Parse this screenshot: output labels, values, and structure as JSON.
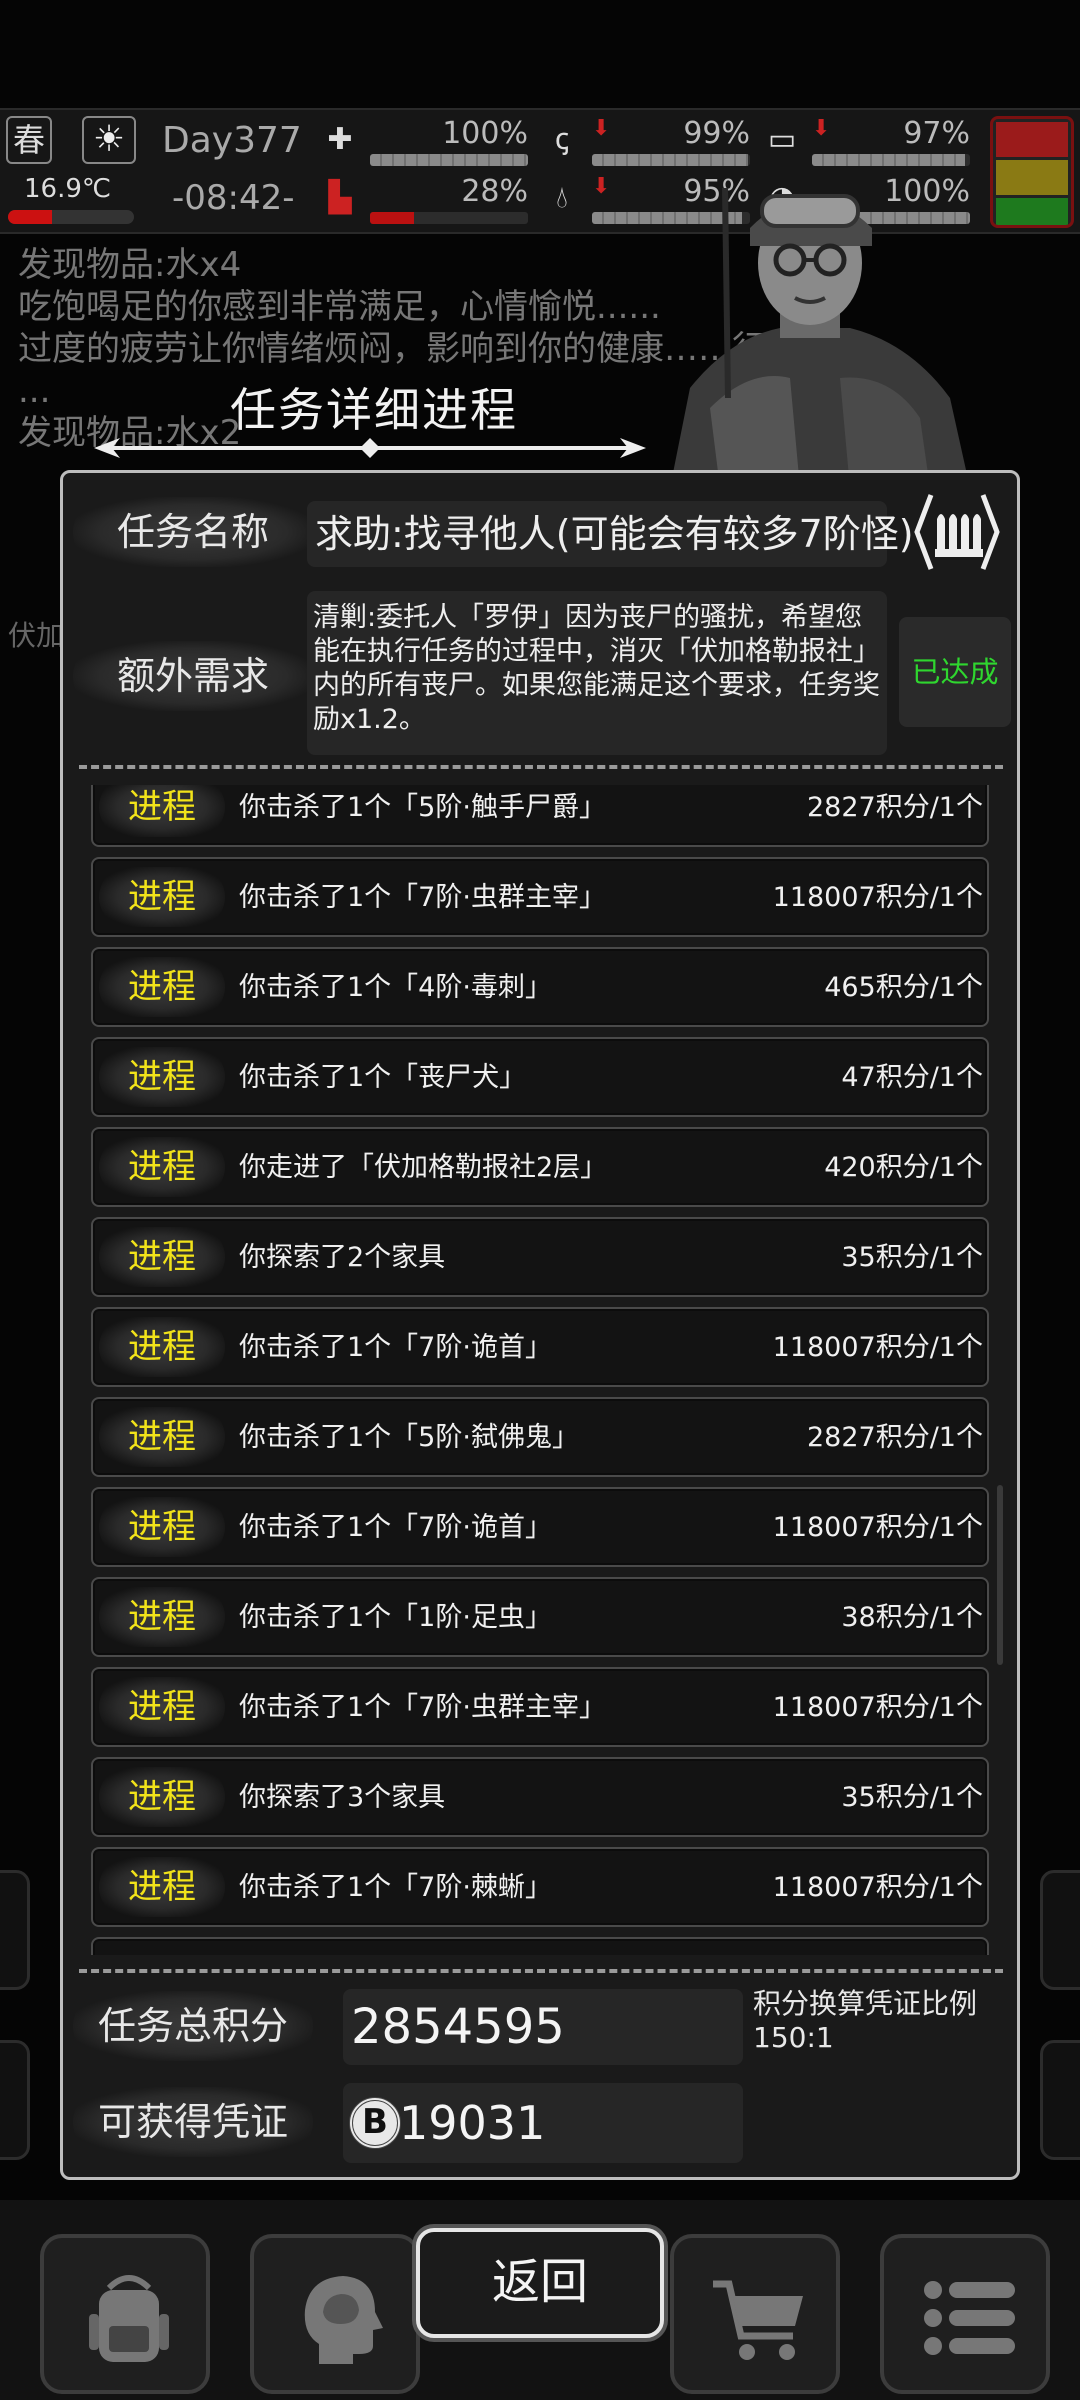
{
  "status": {
    "season": "春",
    "temperature": "16.9℃",
    "temperature_level": 0.35,
    "day": "Day377",
    "time": "-08:42-",
    "stats": [
      {
        "icon": "medkit-icon",
        "value": "100%",
        "level": 1.0
      },
      {
        "icon": "stomach-icon",
        "value": "99%",
        "level": 0.99
      },
      {
        "icon": "battery-icon",
        "value": "97%",
        "level": 0.97
      },
      {
        "icon": "boot-icon",
        "value": "28%",
        "level": 0.28
      },
      {
        "icon": "water-drop-icon",
        "value": "95%",
        "level": 0.95
      },
      {
        "icon": "brain-icon",
        "value": "100%",
        "level": 1.0
      }
    ],
    "alert_colors": [
      "#9b1b1b",
      "#8a7a14",
      "#1e7a1e"
    ]
  },
  "log": {
    "lines": [
      "发现物品:水x4",
      "吃饱喝足的你感到非常满足，心情愉悦......",
      "过度的疲劳让你情绪烦闷，影响到你的健康……行慢跑...",
      "...",
      "发现物品:水x2"
    ],
    "side_label": "伏加"
  },
  "dialog": {
    "heading": "任务详细进程",
    "task_name_label": "任务名称",
    "task_name": "求助:找寻他人(可能会有较多7阶怪)",
    "extra_req_label": "额外需求",
    "extra_req": "清剿:委托人「罗伊」因为丧尸的骚扰，希望您能在执行任务的过程中，消灭「伏加格勒报社」内的所有丧尸。如果您能满足这个要求，任务奖励x1.2。",
    "achieved": "已达成",
    "rows": [
      {
        "tag": "进程",
        "desc": "你击杀了1个「5阶·触手尸爵」",
        "points": "2827积分/1个"
      },
      {
        "tag": "进程",
        "desc": "你击杀了1个「7阶·虫群主宰」",
        "points": "118007积分/1个"
      },
      {
        "tag": "进程",
        "desc": "你击杀了1个「4阶·毒刺」",
        "points": "465积分/1个"
      },
      {
        "tag": "进程",
        "desc": "你击杀了1个「丧尸犬」",
        "points": "47积分/1个"
      },
      {
        "tag": "进程",
        "desc": "你走进了「伏加格勒报社2层」",
        "points": "420积分/1个"
      },
      {
        "tag": "进程",
        "desc": "你探索了2个家具",
        "points": "35积分/1个"
      },
      {
        "tag": "进程",
        "desc": "你击杀了1个「7阶·诡首」",
        "points": "118007积分/1个"
      },
      {
        "tag": "进程",
        "desc": "你击杀了1个「5阶·弑佛鬼」",
        "points": "2827积分/1个"
      },
      {
        "tag": "进程",
        "desc": "你击杀了1个「7阶·诡首」",
        "points": "118007积分/1个"
      },
      {
        "tag": "进程",
        "desc": "你击杀了1个「1阶·足虫」",
        "points": "38积分/1个"
      },
      {
        "tag": "进程",
        "desc": "你击杀了1个「7阶·虫群主宰」",
        "points": "118007积分/1个"
      },
      {
        "tag": "进程",
        "desc": "你探索了3个家具",
        "points": "35积分/1个"
      },
      {
        "tag": "进程",
        "desc": "你击杀了1个「7阶·棘蜥」",
        "points": "118007积分/1个"
      }
    ],
    "total_label": "任务总积分",
    "total_value": "2854595",
    "ratio_label": "积分换算凭证比例",
    "ratio_value": "150:1",
    "credit_label": "可获得凭证",
    "credit_coin": "B",
    "credit_value": "19031",
    "back_label": "返回"
  },
  "nav": [
    "backpack-icon",
    "brain-head-icon",
    "cart-icon",
    "menu-list-icon"
  ]
}
